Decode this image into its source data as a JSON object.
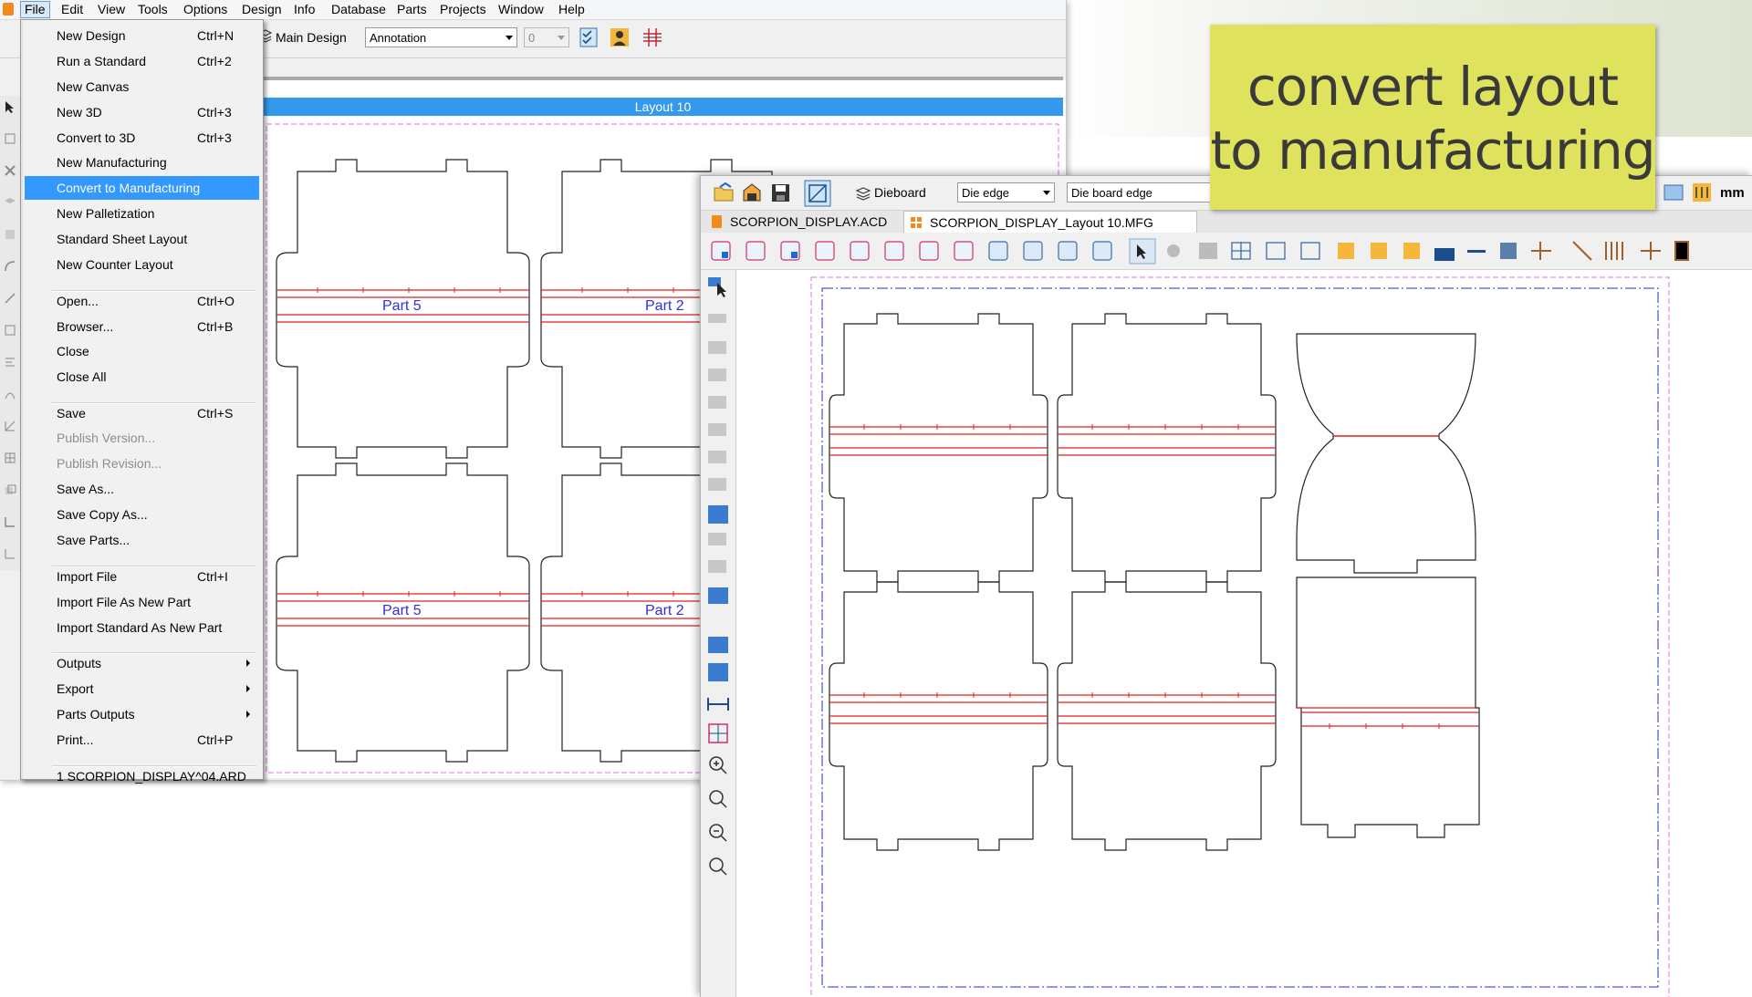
{
  "menubar": {
    "items": [
      "File",
      "Edit",
      "View",
      "Tools",
      "Options",
      "Design",
      "Info",
      "Database",
      "Parts",
      "Projects",
      "Window",
      "Help"
    ]
  },
  "toolbar1": {
    "main_design": "Main Design",
    "annotation": "Annotation",
    "layer_value": "0"
  },
  "layout_title": "Layout 10",
  "parts": [
    "Part 5",
    "Part 2",
    "Part 5",
    "Part 2"
  ],
  "file_menu": [
    {
      "label": "New Design",
      "shortcut": "Ctrl+N"
    },
    {
      "label": "Run a Standard",
      "shortcut": "Ctrl+2"
    },
    {
      "label": "New Canvas",
      "shortcut": ""
    },
    {
      "label": "New 3D",
      "shortcut": "Ctrl+3"
    },
    {
      "label": "Convert to 3D",
      "shortcut": "Ctrl+3"
    },
    {
      "label": "New Manufacturing",
      "shortcut": ""
    },
    {
      "label": "Convert to Manufacturing",
      "shortcut": ""
    },
    {
      "label": "New Palletization",
      "shortcut": ""
    },
    {
      "label": "Standard Sheet Layout",
      "shortcut": ""
    },
    {
      "label": "New Counter Layout",
      "shortcut": ""
    },
    {
      "label": "Open...",
      "shortcut": "Ctrl+O"
    },
    {
      "label": "Browser...",
      "shortcut": "Ctrl+B"
    },
    {
      "label": "Close",
      "shortcut": ""
    },
    {
      "label": "Close All",
      "shortcut": ""
    },
    {
      "label": "Save",
      "shortcut": "Ctrl+S"
    },
    {
      "label": "Publish Version...",
      "shortcut": ""
    },
    {
      "label": "Publish Revision...",
      "shortcut": ""
    },
    {
      "label": "Save As...",
      "shortcut": ""
    },
    {
      "label": "Save Copy As...",
      "shortcut": ""
    },
    {
      "label": "Save Parts...",
      "shortcut": ""
    },
    {
      "label": "Import File",
      "shortcut": "Ctrl+I"
    },
    {
      "label": "Import File As New Part",
      "shortcut": ""
    },
    {
      "label": "Import Standard As New Part",
      "shortcut": ""
    },
    {
      "label": "Outputs",
      "shortcut": ""
    },
    {
      "label": "Export",
      "shortcut": ""
    },
    {
      "label": "Parts Outputs",
      "shortcut": ""
    },
    {
      "label": "Print...",
      "shortcut": "Ctrl+P"
    },
    {
      "label": "1 SCORPION_DISPLAY^04.ARD",
      "shortcut": ""
    }
  ],
  "toolbar2": {
    "dieboard": "Dieboard",
    "die_edge": "Die edge",
    "die_board_edge": "Die board edge",
    "units": "mm"
  },
  "tabs": [
    "SCORPION_DISPLAY.ACD",
    "SCORPION_DISPLAY_Layout 10.MFG"
  ],
  "callout": {
    "line1": "convert layout",
    "line2": "to manufacturing"
  },
  "colors": {
    "menu_highlight": "#3399ff",
    "layout_titlebar": "#3399ee",
    "crease_line": "#e02020",
    "part_label": "#3030d8",
    "callout_bg": "#dfe25c",
    "die_edge": "#1f2fd0",
    "board_edge": "#e070e0"
  }
}
